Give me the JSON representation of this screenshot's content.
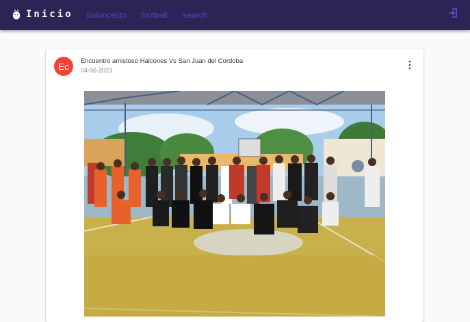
{
  "header": {
    "brand": "Inicio",
    "nav": [
      "baloncesto",
      "football",
      "search"
    ],
    "logout_icon": "logout-icon",
    "colors": {
      "bar": "#2b2556",
      "link": "#5a3fb3"
    }
  },
  "post": {
    "avatar_initials": "Ec",
    "avatar_color": "#f44336",
    "title": "Encuentro amistoso Halcones Vs San Juan del Cordoba",
    "date": "04-06-2023",
    "menu_icon": "more-vert-icon"
  }
}
